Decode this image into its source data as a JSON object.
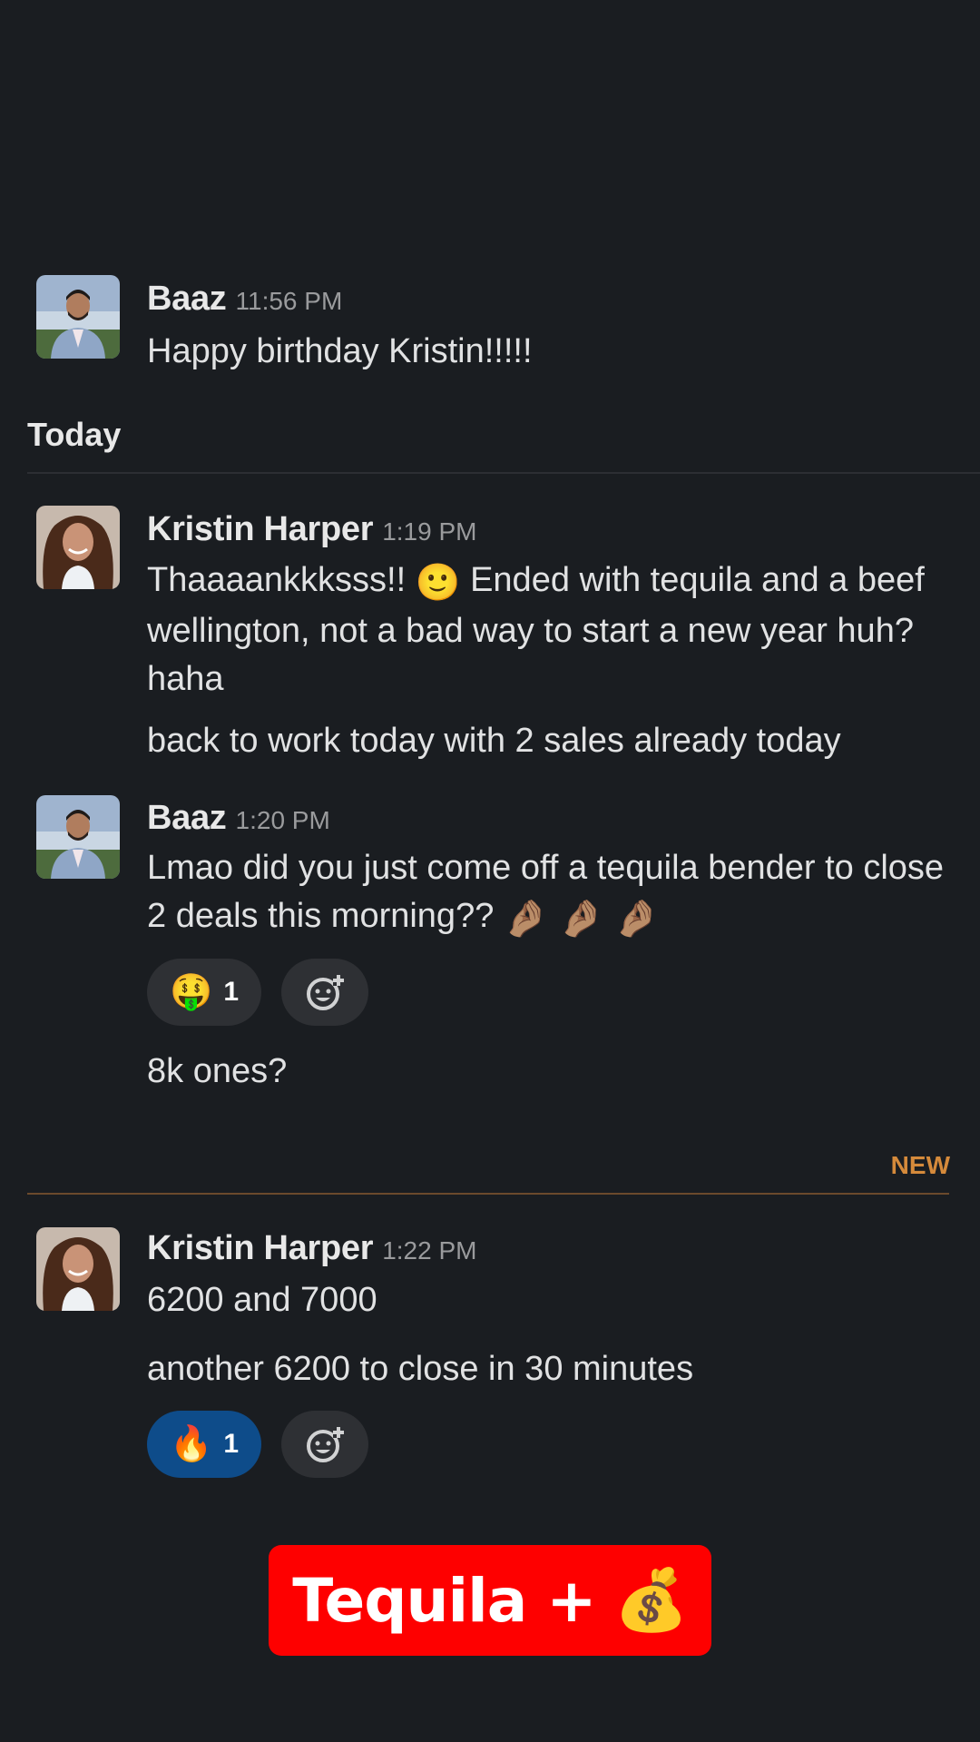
{
  "messages": [
    {
      "author": "Baaz",
      "time": "11:56 PM",
      "avatar": "baaz-avatar",
      "lines": [
        "Happy birthday Kristin!!!!!"
      ]
    },
    {
      "author": "Kristin Harper",
      "time": "1:19 PM",
      "avatar": "kristin-avatar",
      "text_before_emoji": "Thaaaankkksss!!",
      "emoji": "🙂",
      "text_after_emoji": "Ended with tequila and a beef wellington, not a bad way to start a new year huh? haha",
      "line2": "back to work today with 2 sales already today"
    },
    {
      "author": "Baaz",
      "time": "1:20 PM",
      "avatar": "baaz-avatar",
      "text": "Lmao did you just come off a tequila bender to close 2 deals this morning??",
      "trailing_emojis": "🤌🏽 🤌🏽 🤌🏽",
      "reaction": {
        "emoji": "🤑",
        "count": "1"
      },
      "followup": "8k ones?"
    },
    {
      "author": "Kristin Harper",
      "time": "1:22 PM",
      "avatar": "kristin-avatar",
      "line1": "6200 and 7000",
      "line2": "another 6200 to close in 30 minutes",
      "reaction": {
        "emoji": "🔥",
        "count": "1"
      }
    }
  ],
  "day_divider": "Today",
  "new_divider": "NEW",
  "caption": {
    "text": "Tequila +",
    "emoji": "💰"
  },
  "colors": {
    "background": "#1a1d21",
    "new_accent": "#d58a3b",
    "reaction_active": "#0e4c8a",
    "caption_bg": "#fe0000"
  }
}
